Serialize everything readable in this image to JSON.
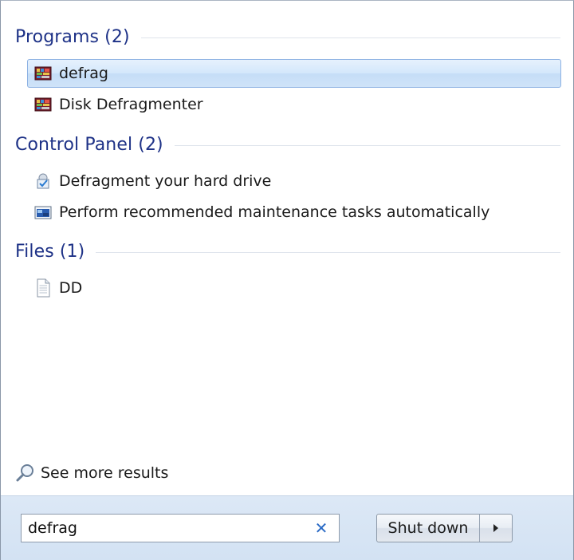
{
  "groups": [
    {
      "title": "Programs (2)",
      "items": [
        {
          "label": "defrag",
          "icon": "defrag-icon"
        },
        {
          "label": "Disk Defragmenter",
          "icon": "defrag-icon"
        }
      ]
    },
    {
      "title": "Control Panel (2)",
      "items": [
        {
          "label": "Defragment your hard drive",
          "icon": "control-panel-task-icon"
        },
        {
          "label": "Perform recommended maintenance tasks automatically",
          "icon": "maintenance-icon"
        }
      ]
    },
    {
      "title": "Files (1)",
      "items": [
        {
          "label": "DD",
          "icon": "text-file-icon"
        }
      ]
    }
  ],
  "see_more": {
    "label": "See more results",
    "icon": "search-icon"
  },
  "search": {
    "value": "defrag",
    "clear_icon": "✕"
  },
  "shutdown": {
    "label": "Shut down",
    "arrow_icon": "chevron-right-icon"
  },
  "colors": {
    "header": "#1e3287",
    "selection_border": "#8db2e3",
    "bottom_bar": "#d3e2f3",
    "accent_clear": "#2b6bc6"
  }
}
